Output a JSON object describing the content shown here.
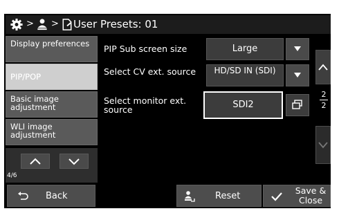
{
  "title": "User Presets: 01",
  "breadcrumb_sep": ">",
  "sidebar": {
    "items": [
      {
        "label": "Display preferences"
      },
      {
        "label": "PIP/POP"
      },
      {
        "label": "Basic image adjustment"
      },
      {
        "label": "WLI image adjustment"
      }
    ],
    "page_indicator": "4/6"
  },
  "settings": [
    {
      "label": "PIP Sub screen size",
      "value": "Large"
    },
    {
      "label": "Select CV ext. source",
      "value": "HD/SD IN (SDI)"
    },
    {
      "label": "Select monitor ext. source",
      "value": "SDI2"
    }
  ],
  "right_scroll": {
    "page": "2",
    "total": "2"
  },
  "bottom": {
    "back_label": "Back",
    "reset_label": "Reset",
    "save_close_label": "Save & Close"
  },
  "colors": {
    "active_sidebar": "#cfcfcf",
    "panel": "#000000",
    "button": "#4d4d4d"
  },
  "icons": [
    "gear-icon",
    "user-icon",
    "document-icon",
    "back-arrow-icon",
    "reset-user-icon",
    "checkmark-icon",
    "monitor-switch-icon",
    "chevron-up-icon",
    "chevron-down-icon"
  ]
}
